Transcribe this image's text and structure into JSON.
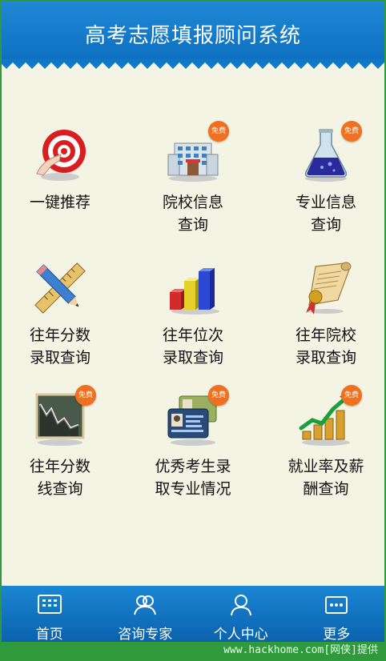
{
  "header": {
    "title": "高考志愿填报顾问系统"
  },
  "tiles": [
    {
      "line1": "一键推荐",
      "line2": "",
      "icon": "target-icon",
      "badge": ""
    },
    {
      "line1": "院校信息",
      "line2": "查询",
      "icon": "school-building-icon",
      "badge": "免费"
    },
    {
      "line1": "专业信息",
      "line2": "查询",
      "icon": "flask-icon",
      "badge": "免费"
    },
    {
      "line1": "往年分数",
      "line2": "录取查询",
      "icon": "pencil-ruler-icon",
      "badge": ""
    },
    {
      "line1": "往年位次",
      "line2": "录取查询",
      "icon": "bar-chart-icon",
      "badge": ""
    },
    {
      "line1": "往年院校",
      "line2": "录取查询",
      "icon": "scroll-icon",
      "badge": ""
    },
    {
      "line1": "往年分数",
      "line2": "线查询",
      "icon": "line-chart-icon",
      "badge": "免费"
    },
    {
      "line1": "优秀考生录",
      "line2": "取专业情况",
      "icon": "id-cards-icon",
      "badge": "免费"
    },
    {
      "line1": "就业率及薪",
      "line2": "酬查询",
      "icon": "coins-growth-icon",
      "badge": "免费"
    }
  ],
  "tabbar": [
    {
      "label": "首页",
      "icon": "home-grid-icon"
    },
    {
      "label": "咨询专家",
      "icon": "experts-icon"
    },
    {
      "label": "个人中心",
      "icon": "person-icon"
    },
    {
      "label": "更多",
      "icon": "more-icon"
    }
  ],
  "watermark": "www.hackhome.com[网侠]提供",
  "colors": {
    "header": "#1f88d6",
    "tabbar": "#0b62ad",
    "badge": "#f07020",
    "frame": "#2f9a3c"
  }
}
